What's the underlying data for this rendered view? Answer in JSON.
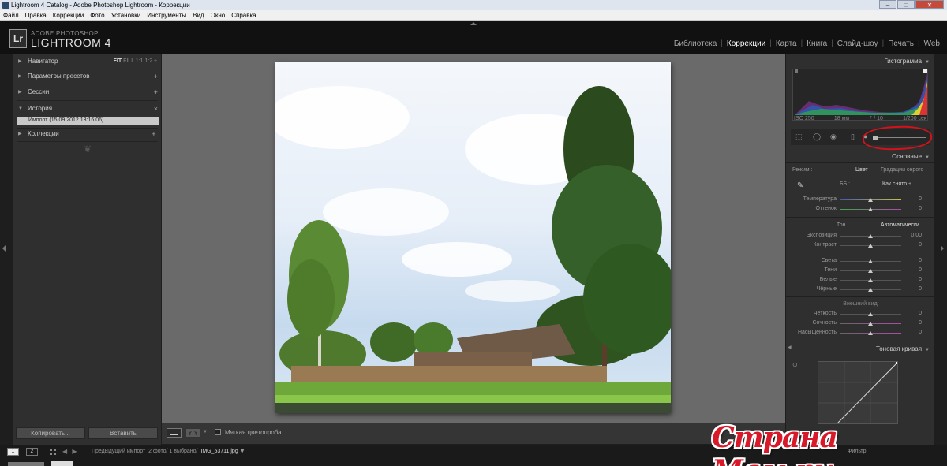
{
  "window": {
    "title": "Lightroom 4 Catalog - Adobe Photoshop Lightroom - Коррекции",
    "controls": [
      "–",
      "□",
      "✕"
    ]
  },
  "menubar": [
    "Файл",
    "Правка",
    "Коррекции",
    "Фото",
    "Установки",
    "Инструменты",
    "Вид",
    "Окно",
    "Справка"
  ],
  "header": {
    "logo": "Lr",
    "brand_small": "ADOBE PHOTOSHOP",
    "brand_big": "LIGHTROOM 4",
    "modules": [
      {
        "label": "Библиотека",
        "active": false
      },
      {
        "label": "Коррекции",
        "active": true
      },
      {
        "label": "Карта",
        "active": false
      },
      {
        "label": "Книга",
        "active": false
      },
      {
        "label": "Слайд-шоу",
        "active": false
      },
      {
        "label": "Печать",
        "active": false
      },
      {
        "label": "Web",
        "active": false
      }
    ]
  },
  "left_panel": {
    "navigator": {
      "label": "Навигатор",
      "zoom": {
        "fit": "FIT",
        "fill": "FILL",
        "z1": "1:1",
        "z2": "1:2 ÷"
      }
    },
    "presets": {
      "label": "Параметры пресетов",
      "action": "+"
    },
    "sessions": {
      "label": "Сессии",
      "action": "+"
    },
    "history": {
      "label": "История",
      "action": "×",
      "item": "Импорт (15.09.2012 13:16:06)"
    },
    "collections": {
      "label": "Коллекции",
      "action": "+."
    },
    "ornament": "❦",
    "copy_button": "Копировать...",
    "paste_button": "Вставить"
  },
  "toolbar": {
    "yy": "Y|Y",
    "soft_proof": "Мягкая цветопроба"
  },
  "right_panel": {
    "histogram_label": "Гистограмма",
    "exif": {
      "iso": "ISO 250",
      "focal": "18 мм",
      "aperture": "ƒ / 10",
      "shutter": "1/200 сек"
    },
    "basic": {
      "label": "Основные",
      "mode_label": "Режим :",
      "color": "Цвет",
      "gray": "Градации серого",
      "wb_label": "ББ :",
      "wb_value": "Как снято ÷",
      "temp": {
        "label": "Температура",
        "value": "0"
      },
      "tint": {
        "label": "Оттенок",
        "value": "0"
      },
      "tone_label": "Тон",
      "auto": "Автоматически",
      "exposure": {
        "label": "Экспозиция",
        "value": "0,00"
      },
      "contrast": {
        "label": "Контраст",
        "value": "0"
      },
      "highlights": {
        "label": "Света",
        "value": "0"
      },
      "shadows": {
        "label": "Тени",
        "value": "0"
      },
      "whites": {
        "label": "Белые",
        "value": "0"
      },
      "blacks": {
        "label": "Чёрные",
        "value": "0"
      },
      "presence_label": "Внешний вид",
      "clarity": {
        "label": "Чёткость",
        "value": "0"
      },
      "vibrance": {
        "label": "Сочность",
        "value": "0"
      },
      "saturation": {
        "label": "Насыщенность",
        "value": "0"
      }
    },
    "tone_curve_label": "Тоновая кривая"
  },
  "filmstrip": {
    "view1": "1",
    "view2": "2",
    "source_prefix": "Предыдущий импорт",
    "source_count": "2 фото/ 1 выбрано/",
    "file": "IMG_53711.jpg",
    "filter_label": "Фильтр:"
  },
  "watermark": "Страна Мам.ру",
  "colors": {
    "highlight_circle": "#d3121b",
    "watermark": "#d8192a",
    "panel": "#2f2f2f",
    "workspace": "#6a6a6a"
  }
}
